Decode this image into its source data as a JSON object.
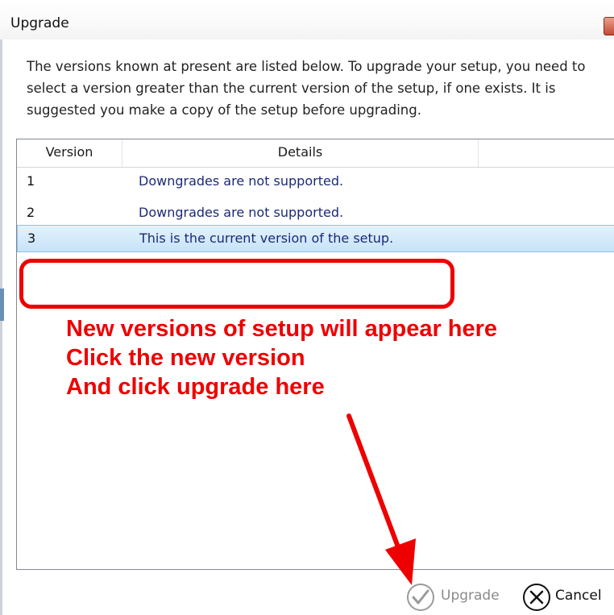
{
  "window": {
    "title": "Upgrade"
  },
  "description": "The versions known at present are listed below. To upgrade your setup, you need to select a version greater than the current version of the setup, if one exists. It is suggested you make a copy of the setup before upgrading.",
  "table": {
    "columns": [
      "Version",
      "Details"
    ],
    "rows": [
      {
        "version": "1",
        "details": "Downgrades are not supported.",
        "selected": false
      },
      {
        "version": "2",
        "details": "Downgrades are not supported.",
        "selected": false
      },
      {
        "version": "3",
        "details": "This is the current version of the setup.",
        "selected": true
      }
    ]
  },
  "annotation": {
    "lines": [
      "New versions of setup will appear here",
      "Click the new version",
      "And click upgrade here"
    ],
    "color": "#ee0000"
  },
  "buttons": {
    "upgrade": {
      "label": "Upgrade",
      "icon": "check-circle-icon",
      "enabled": false
    },
    "cancel": {
      "label": "Cancel",
      "icon": "x-circle-icon"
    }
  },
  "colors": {
    "selection": "#c6e3f8",
    "text_link": "#1b2a78",
    "close_button": "#c44a34"
  }
}
